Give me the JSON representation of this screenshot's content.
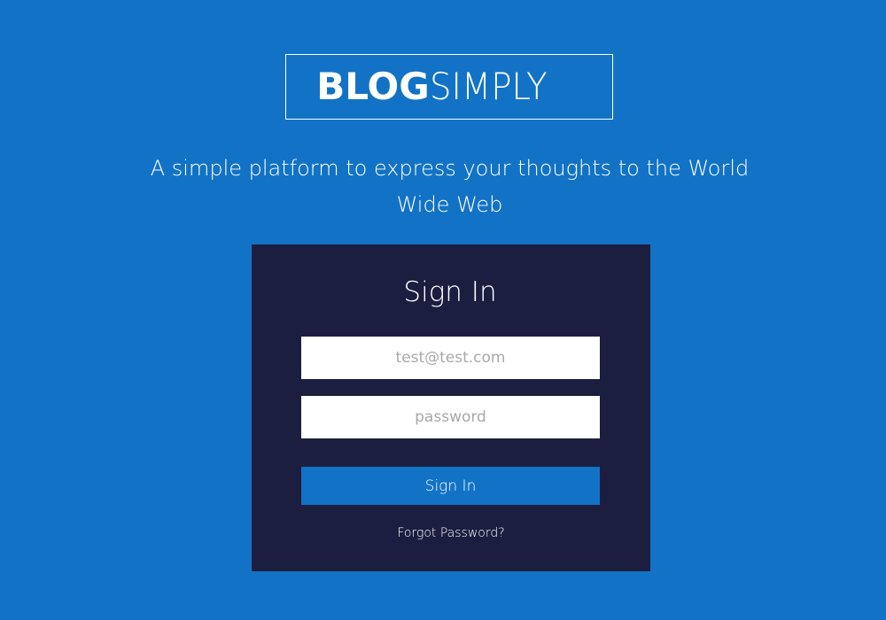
{
  "colors": {
    "background": "#1273c6",
    "panel": "#1c1e40",
    "button": "#1273c6",
    "field": "#ffffff",
    "placeholder": "#a8a8a8"
  },
  "brand": {
    "bold": "BLOG",
    "light": "SIMPLY"
  },
  "tagline": "A simple platform to express your thoughts to the World Wide Web",
  "signin": {
    "title": "Sign In",
    "email_placeholder": "test@test.com",
    "email_value": "",
    "password_placeholder": "password",
    "password_value": "",
    "button_label": "Sign In",
    "forgot_label": "Forgot Password?"
  }
}
